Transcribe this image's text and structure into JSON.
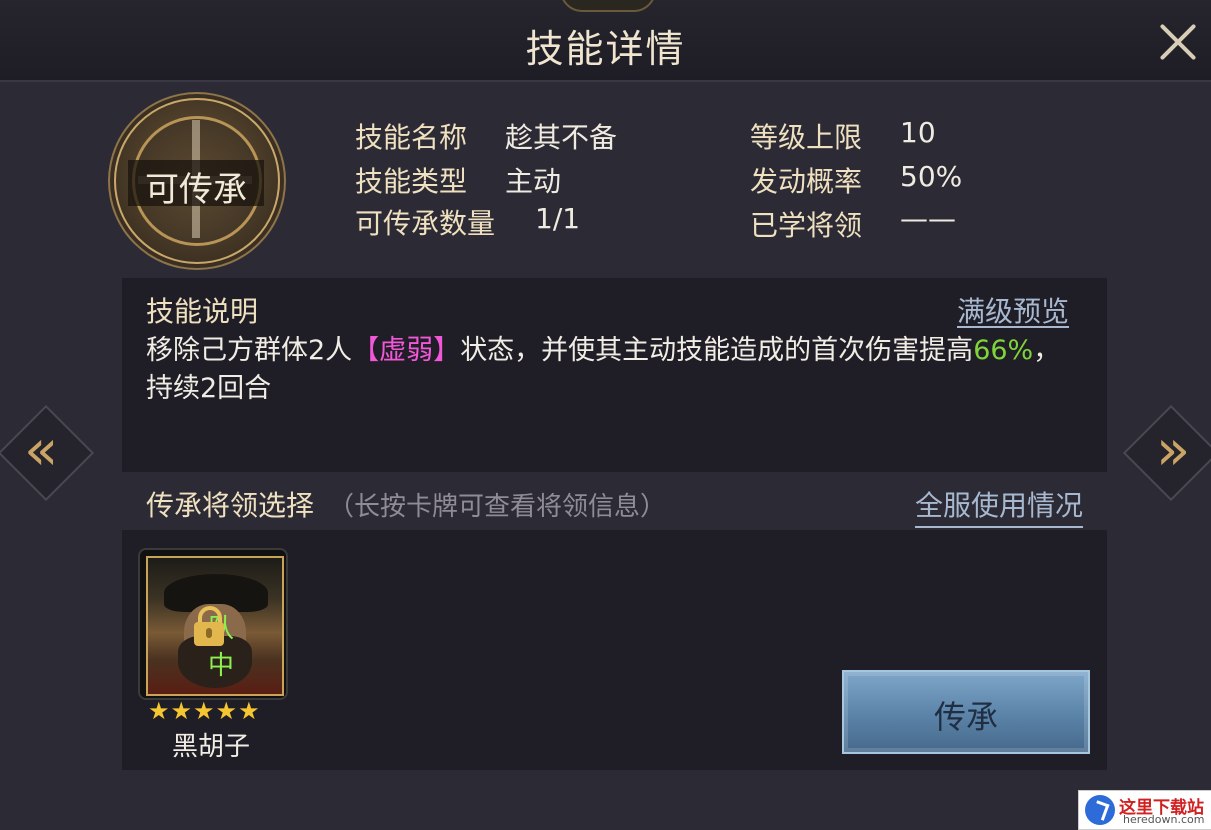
{
  "header": {
    "title": "技能详情"
  },
  "badge": {
    "text": "可传承"
  },
  "skill_info": {
    "name_label": "技能名称",
    "name_value": "趁其不备",
    "type_label": "技能类型",
    "type_value": "主动",
    "count_label": "可传承数量",
    "count_value": "1/1",
    "level_cap_label": "等级上限",
    "level_cap_value": "10",
    "chance_label": "发动概率",
    "chance_value": "50%",
    "learned_label": "已学将领",
    "learned_value": "——"
  },
  "description": {
    "title": "技能说明",
    "preview_link": "满级预览",
    "text_before": "移除己方群体2人",
    "keyword": "【虚弱】",
    "text_middle": "状态，并使其主动技能造成的首次伤害提高",
    "highlight": "66%",
    "text_after": "，持续2回合",
    "colors": {
      "keyword": "#f257d8",
      "highlight": "#7fd43a"
    }
  },
  "inherit": {
    "title": "传承将领选择",
    "hint": "（长按卡牌可查看将领信息）",
    "server_link": "全服使用情况",
    "button_label": "传承"
  },
  "hero_card": {
    "name": "黑胡子",
    "stars": "★★★★★",
    "star_count": 5,
    "tag": "队中",
    "locked": true,
    "icon": "lock-icon"
  },
  "watermark": {
    "title": "这里下载站",
    "url": "heredown.com"
  }
}
